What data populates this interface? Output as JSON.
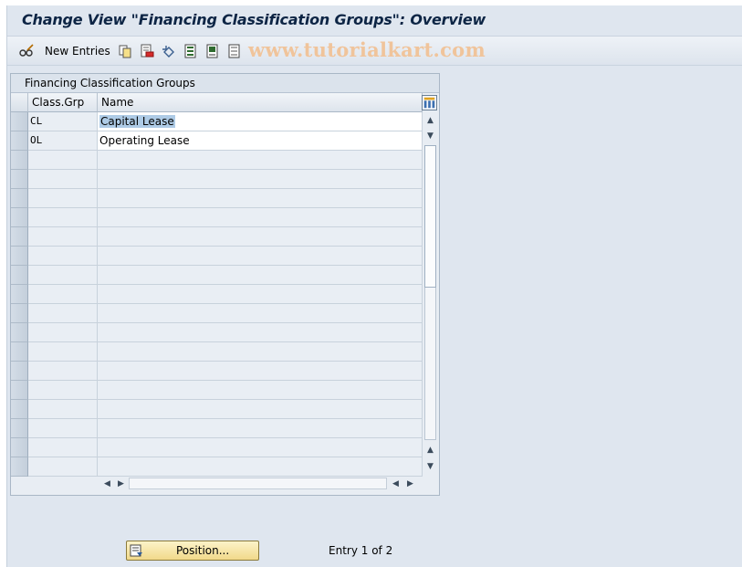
{
  "window": {
    "title": "Change View \"Financing Classification Groups\": Overview"
  },
  "toolbar": {
    "new_entries_label": "New Entries",
    "icons": [
      "glasses-edit-icon",
      "copy-icon",
      "delete-icon",
      "undo-icon",
      "select-all-icon",
      "select-block-icon",
      "deselect-all-icon"
    ],
    "watermark": "www.tutorialkart.com"
  },
  "panel": {
    "title": "Financing Classification Groups",
    "columns": [
      "Class.Grp",
      "Name"
    ],
    "rows": [
      {
        "key": "CL",
        "name": "Capital Lease",
        "selected_text": true
      },
      {
        "key": "OL",
        "name": "Operating Lease",
        "selected_text": false
      }
    ],
    "empty_rows": 17
  },
  "footer": {
    "position_button_label": "Position...",
    "entry_info": "Entry 1 of 2"
  }
}
